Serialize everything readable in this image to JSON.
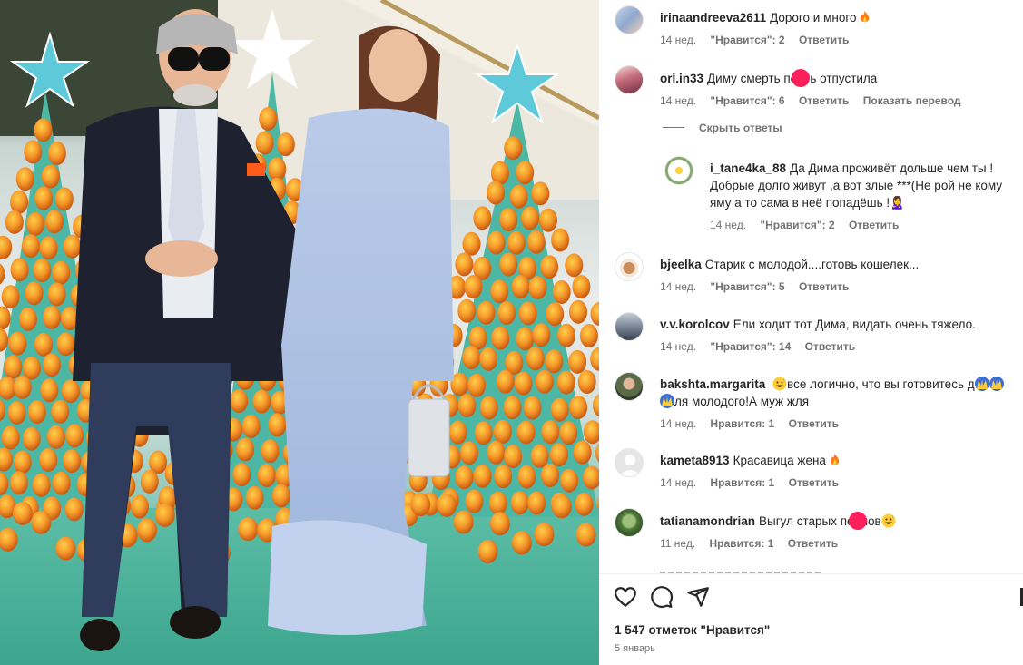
{
  "post": {
    "likes_label": "1 547 отметок \"Нравится\"",
    "date": "5 январь"
  },
  "hide_replies_label": "Скрыть ответы",
  "comments": [
    {
      "username": "irinaandreeva2611",
      "text": "Дорого и много",
      "emoji": "fire",
      "time": "14 нед.",
      "likes": "\"Нравится\": 2",
      "reply": "Ответить"
    },
    {
      "username": "orl.in33",
      "text_before": "Диму смерть по",
      "text_after": "ть отпустила",
      "time": "14 нед.",
      "likes": "\"Нравится\": 6",
      "reply": "Ответить",
      "translate": "Показать перевод"
    },
    {
      "username": "i_tane4ka_88",
      "text": "Да Дима проживёт дольше чем ты ! Добрые долго живут ,а вот злые ***(Не рой не кому яму а то сама в неё попадёшь !",
      "emoji_tail": "🙎‍♀",
      "time": "14 нед.",
      "likes": "\"Нравится\": 2",
      "reply": "Ответить"
    },
    {
      "username": "bjeelka",
      "text": "Старик с молодой....готовь кошелек...",
      "time": "14 нед.",
      "likes": "\"Нравится\": 5",
      "reply": "Ответить"
    },
    {
      "username": "v.v.korolcov",
      "text": "Ели ходит тот Дима, видать очень тяжело.",
      "time": "14 нед.",
      "likes": "\"Нравится\": 14",
      "reply": "Ответить"
    },
    {
      "username": "bakshta.margarita",
      "text_1": "все логично, что вы готовитесь д",
      "text_2": "ля молодого!А муж жля",
      "time": "14 нед.",
      "likes": "Нравится: 1",
      "reply": "Ответить"
    },
    {
      "username": "kameta8913",
      "text": "Красавица жена",
      "emoji": "fire",
      "time": "14 нед.",
      "likes": "Нравится: 1",
      "reply": "Ответить"
    },
    {
      "username": "tatianamondrian",
      "text_before": "Выгул старых пе",
      "text_after": "нов",
      "time": "11 нед.",
      "likes": "Нравится: 1",
      "reply": "Ответить"
    }
  ],
  "colors": {
    "text": "#262626",
    "muted": "#737373",
    "blot": "#ff1f5a",
    "fire": "#ff7a1a"
  },
  "icons": [
    "heart-icon",
    "comment-icon",
    "share-icon",
    "fire-emoji",
    "grinning-sweat-emoji",
    "raised-hands-emoji"
  ]
}
